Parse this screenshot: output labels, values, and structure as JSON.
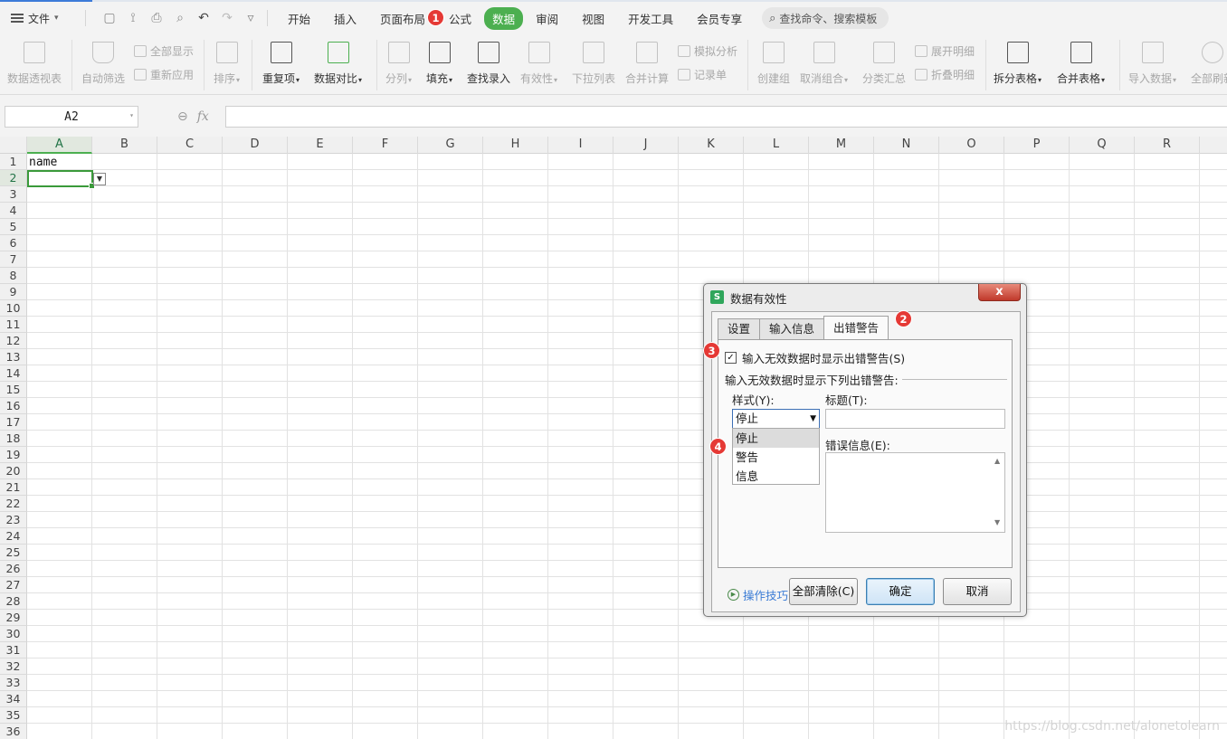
{
  "menubar": {
    "file_label": "文件",
    "tabs": [
      {
        "label": "开始",
        "name": "tab-home"
      },
      {
        "label": "插入",
        "name": "tab-insert"
      },
      {
        "label": "页面布局",
        "name": "tab-page-layout"
      },
      {
        "label": "公式",
        "name": "tab-formulas"
      },
      {
        "label": "数据",
        "name": "tab-data",
        "active": true
      },
      {
        "label": "审阅",
        "name": "tab-review"
      },
      {
        "label": "视图",
        "name": "tab-view"
      },
      {
        "label": "开发工具",
        "name": "tab-developer"
      },
      {
        "label": "会员专享",
        "name": "tab-member"
      }
    ],
    "search_placeholder": "查找命令、搜索模板"
  },
  "ribbon": {
    "pivot": "数据透视表",
    "autofilter": "自动筛选",
    "show_all": "全部显示",
    "reapply": "重新应用",
    "sort": "排序",
    "duplicates": "重复项",
    "compare": "数据对比",
    "split": "分列",
    "fill": "填充",
    "lookup_entry": "查找录入",
    "validity": "有效性",
    "dropdown_list": "下拉列表",
    "consolidate": "合并计算",
    "simulate": "模拟分析",
    "record_form": "记录单",
    "create_group": "创建组",
    "ungroup": "取消组合",
    "subtotal": "分类汇总",
    "expand_detail": "展开明细",
    "collapse_detail": "折叠明细",
    "split_table": "拆分表格",
    "merge_table": "合并表格",
    "import_data": "导入数据",
    "refresh_all": "全部刷新"
  },
  "formula_bar": {
    "name_box": "A2",
    "fx": "fx",
    "formula": ""
  },
  "sheet": {
    "columns": [
      "A",
      "B",
      "C",
      "D",
      "E",
      "F",
      "G",
      "H",
      "I",
      "J",
      "K",
      "L",
      "M",
      "N",
      "O",
      "P",
      "Q",
      "R"
    ],
    "rows": [
      "1",
      "2",
      "3",
      "4",
      "5",
      "6",
      "7",
      "8",
      "9",
      "10",
      "11",
      "12",
      "13",
      "14",
      "15",
      "16",
      "17",
      "18",
      "19",
      "20",
      "21",
      "22",
      "23",
      "24",
      "25",
      "26",
      "27",
      "28",
      "29",
      "30",
      "31",
      "32",
      "33",
      "34",
      "35",
      "36"
    ],
    "cell_A1": "name",
    "watermark": "https://blog.csdn.net/alonetolearn"
  },
  "dialog": {
    "title": "数据有效性",
    "close": "x",
    "tabs": [
      "设置",
      "输入信息",
      "出错警告"
    ],
    "checkbox_label": "输入无效数据时显示出错警告(S)",
    "checkbox_checked": "✓",
    "group_label": "输入无效数据时显示下列出错警告:",
    "style_label": "样式(Y):",
    "style_value": "停止",
    "style_options": [
      "停止",
      "警告",
      "信息"
    ],
    "title_label": "标题(T):",
    "title_value": "",
    "error_label": "错误信息(E):",
    "error_value": "",
    "tips": "操作技巧",
    "clear_all": "全部清除(C)",
    "ok": "确定",
    "cancel": "取消"
  },
  "markers": [
    "1",
    "2",
    "3",
    "4"
  ],
  "colors": {
    "accent_green": "#4caf50",
    "marker_red": "#e53935",
    "link_blue": "#3a7bd5"
  }
}
